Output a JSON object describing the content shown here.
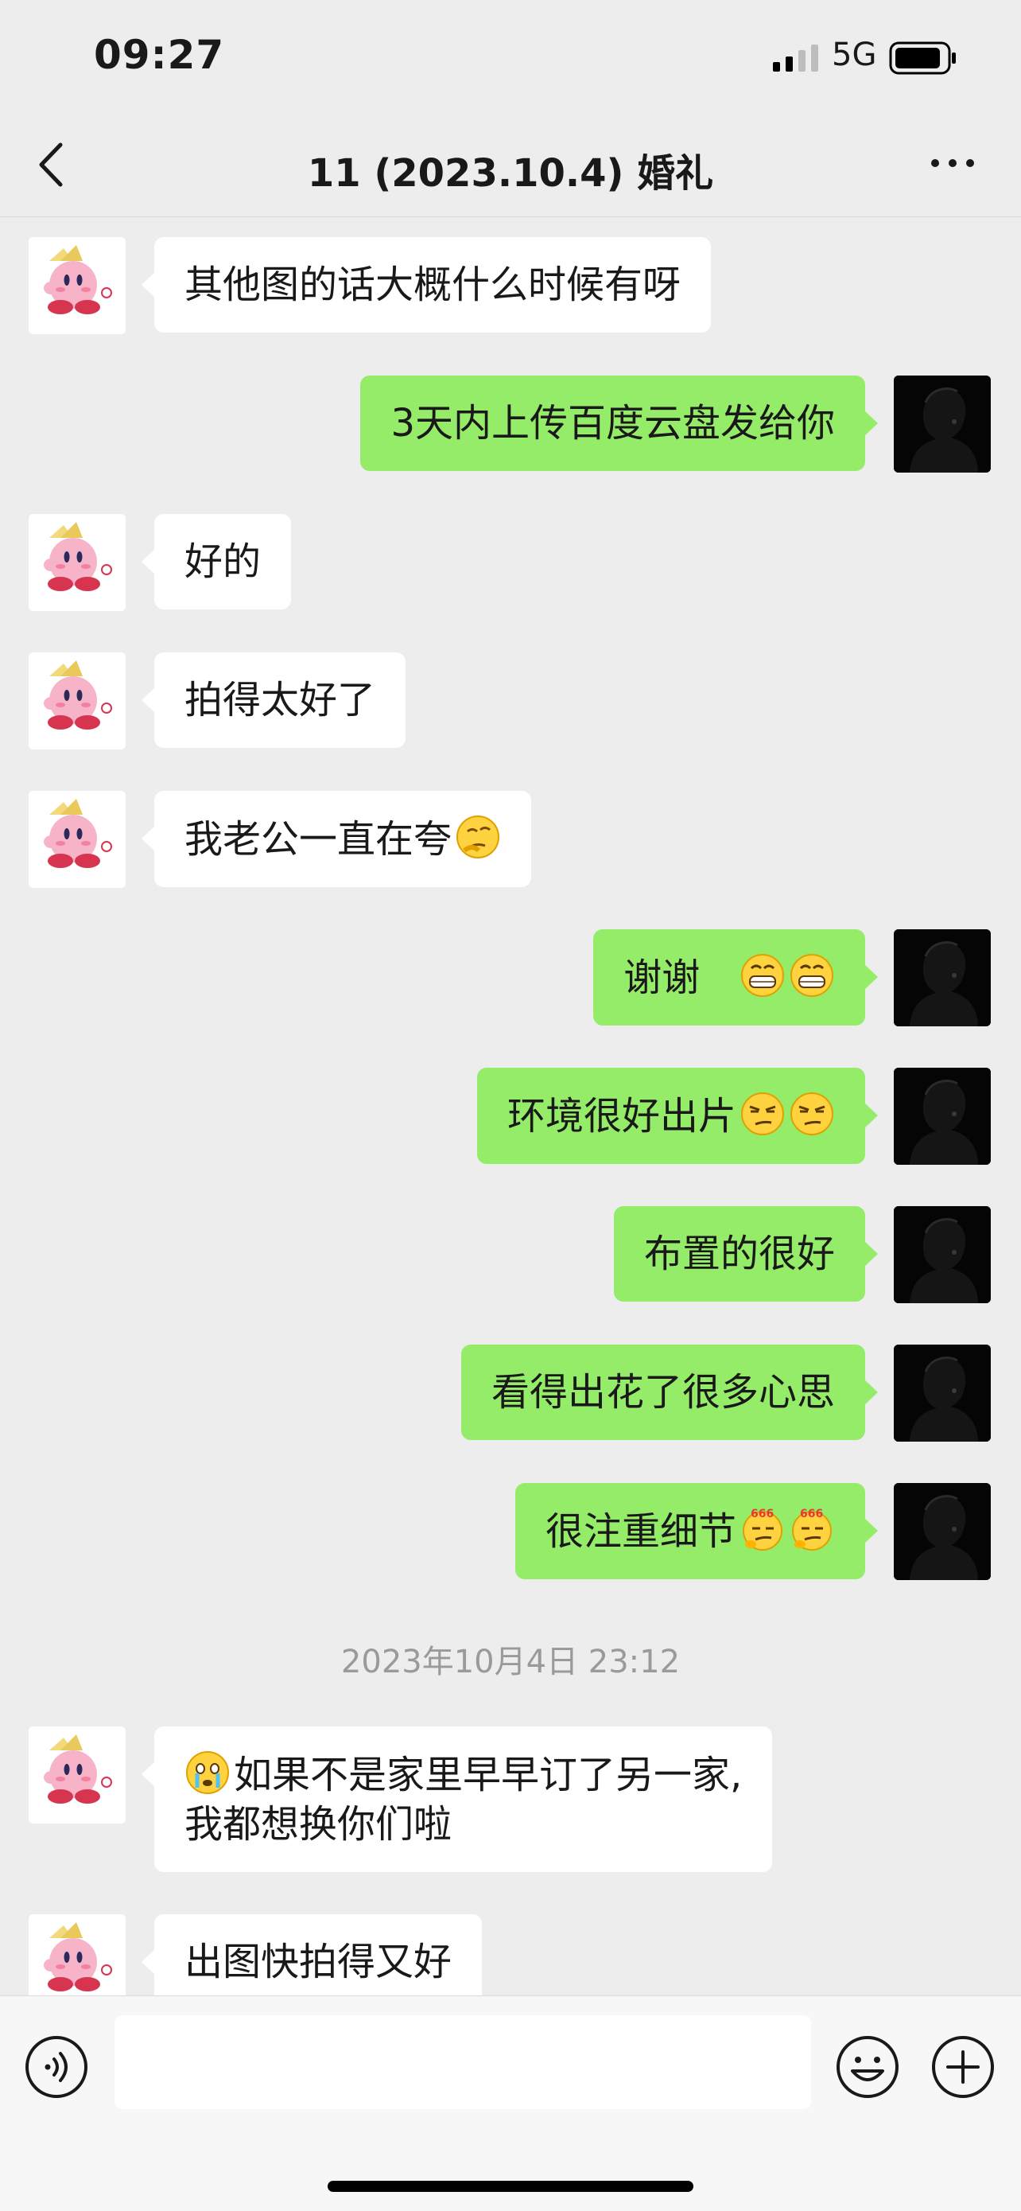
{
  "status_bar": {
    "time": "09:27",
    "network": "5G"
  },
  "nav": {
    "title": "11 (2023.10.4) 婚礼"
  },
  "messages": [
    {
      "side": "left",
      "text": "其他图的话大概什么时候有呀"
    },
    {
      "side": "right",
      "text": "3天内上传百度云盘发给你"
    },
    {
      "side": "left",
      "text": "好的"
    },
    {
      "side": "left",
      "text": "拍得太好了"
    },
    {
      "side": "left",
      "text": "我老公一直在夸",
      "emoji": "thinking-face"
    },
    {
      "side": "right",
      "text": "谢谢 ",
      "emoji": "grinning-face"
    },
    {
      "side": "right",
      "text": "环境很好出片",
      "emoji": "smirking-face"
    },
    {
      "side": "right",
      "text": "布置的很好"
    },
    {
      "side": "right",
      "text": "看得出花了很多心思"
    },
    {
      "side": "right",
      "text": "很注重细节",
      "emoji": "666-face"
    }
  ],
  "timestamp": "2023年10月4日 23:12",
  "messages_after": [
    {
      "side": "left",
      "line1": "如果不是家里早早订了另一家,",
      "line2": "我都想换你们啦",
      "emoji": "crying-face"
    },
    {
      "side": "left",
      "text": "出图快拍得又好"
    }
  ],
  "colors": {
    "background": "#ededed",
    "self_bubble": "#95ec69",
    "other_bubble": "#ffffff"
  }
}
